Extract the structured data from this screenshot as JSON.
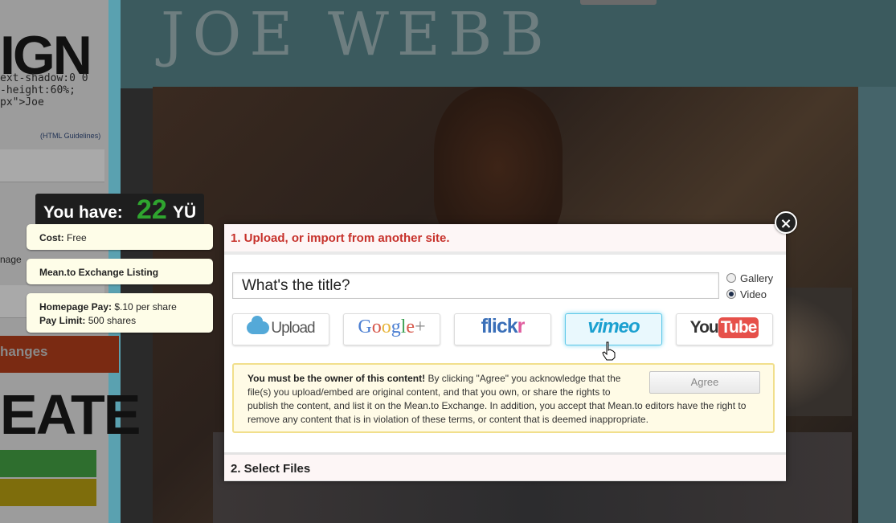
{
  "background": {
    "logo_text": "IGN",
    "code_lines": "ext-shadow:0 0\n-height:60%;\npx\">Joe",
    "guidelines_link": "(HTML Guidelines)",
    "manage_text": "nage",
    "changes_label": "hanges",
    "create_text": "EATE",
    "page_title": "JOE WEBB"
  },
  "credits": {
    "label": "You have:",
    "amount": "22",
    "unit": "YÜ"
  },
  "info_cards": {
    "cost_label": "Cost:",
    "cost_value": "Free",
    "listing": "Mean.to Exchange Listing",
    "homepage_pay_label": "Homepage Pay:",
    "homepage_pay_value": "$.10 per share",
    "pay_limit_label": "Pay Limit:",
    "pay_limit_value": "500 shares"
  },
  "modal": {
    "close_symbol": "×",
    "section1_title": "1. Upload, or import from another site.",
    "title_placeholder": "What's the title?",
    "radio_gallery": "Gallery",
    "radio_video": "Video",
    "selected_type": "Video",
    "sources": {
      "upload": "Upload",
      "google": "Google+",
      "flickr": "flickr",
      "vimeo": "vimeo",
      "youtube_you": "You",
      "youtube_tube": "Tube"
    },
    "active_source": "vimeo",
    "agreement": {
      "bold_lead": "You must be the owner of this content!",
      "body": " By clicking \"Agree\" you acknowledge that the file(s) you upload/embed are original content, and that you own, or share the rights to publish the content, and list it on the Mean.to Exchange. In addition, you accept that Mean.to editors have the right to remove any content that is in violation of these terms, or content that is deemed inappropriate.",
      "agree_button": "Agree"
    },
    "section2_title": "2. Select Files"
  },
  "colors": {
    "section1_title": "#c7312b",
    "credits_amount": "#2fa52f",
    "vimeo": "#1ba0d0",
    "youtube_red": "#e6504a",
    "agree_border": "#f1df8c"
  }
}
